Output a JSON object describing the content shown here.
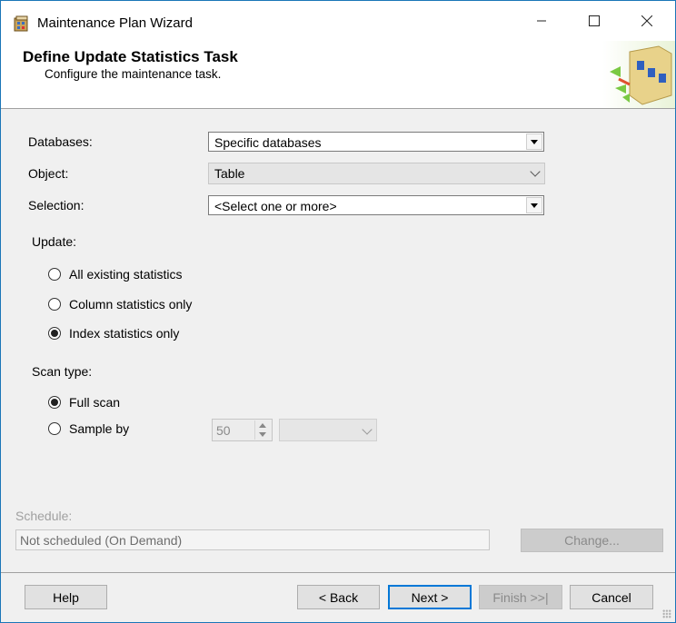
{
  "window": {
    "title": "Maintenance Plan Wizard",
    "controls": {
      "minimize": "—",
      "maximize": "☐",
      "close": "✕"
    }
  },
  "header": {
    "title": "Define Update Statistics Task",
    "subtitle": "Configure the maintenance task."
  },
  "form": {
    "databases": {
      "label": "Databases:",
      "value": "Specific databases"
    },
    "object": {
      "label": "Object:",
      "value": "Table"
    },
    "selection": {
      "label": "Selection:",
      "value": "<Select one or more>"
    },
    "update": {
      "label": "Update:",
      "options": [
        {
          "label": "All existing statistics",
          "checked": false
        },
        {
          "label": "Column statistics only",
          "checked": false
        },
        {
          "label": "Index statistics only",
          "checked": true
        }
      ]
    },
    "scan_type": {
      "label": "Scan type:",
      "options": [
        {
          "label": "Full scan",
          "checked": true
        },
        {
          "label": "Sample by",
          "checked": false
        }
      ],
      "sample_value": "50",
      "sample_unit": ""
    }
  },
  "schedule": {
    "label": "Schedule:",
    "value": "Not scheduled (On Demand)",
    "change_button": "Change..."
  },
  "buttons": {
    "help": "Help",
    "back": "< Back",
    "next": "Next >",
    "finish": "Finish >>|",
    "cancel": "Cancel"
  },
  "colors": {
    "accent": "#0078d7",
    "window_border": "#1b76b8"
  }
}
